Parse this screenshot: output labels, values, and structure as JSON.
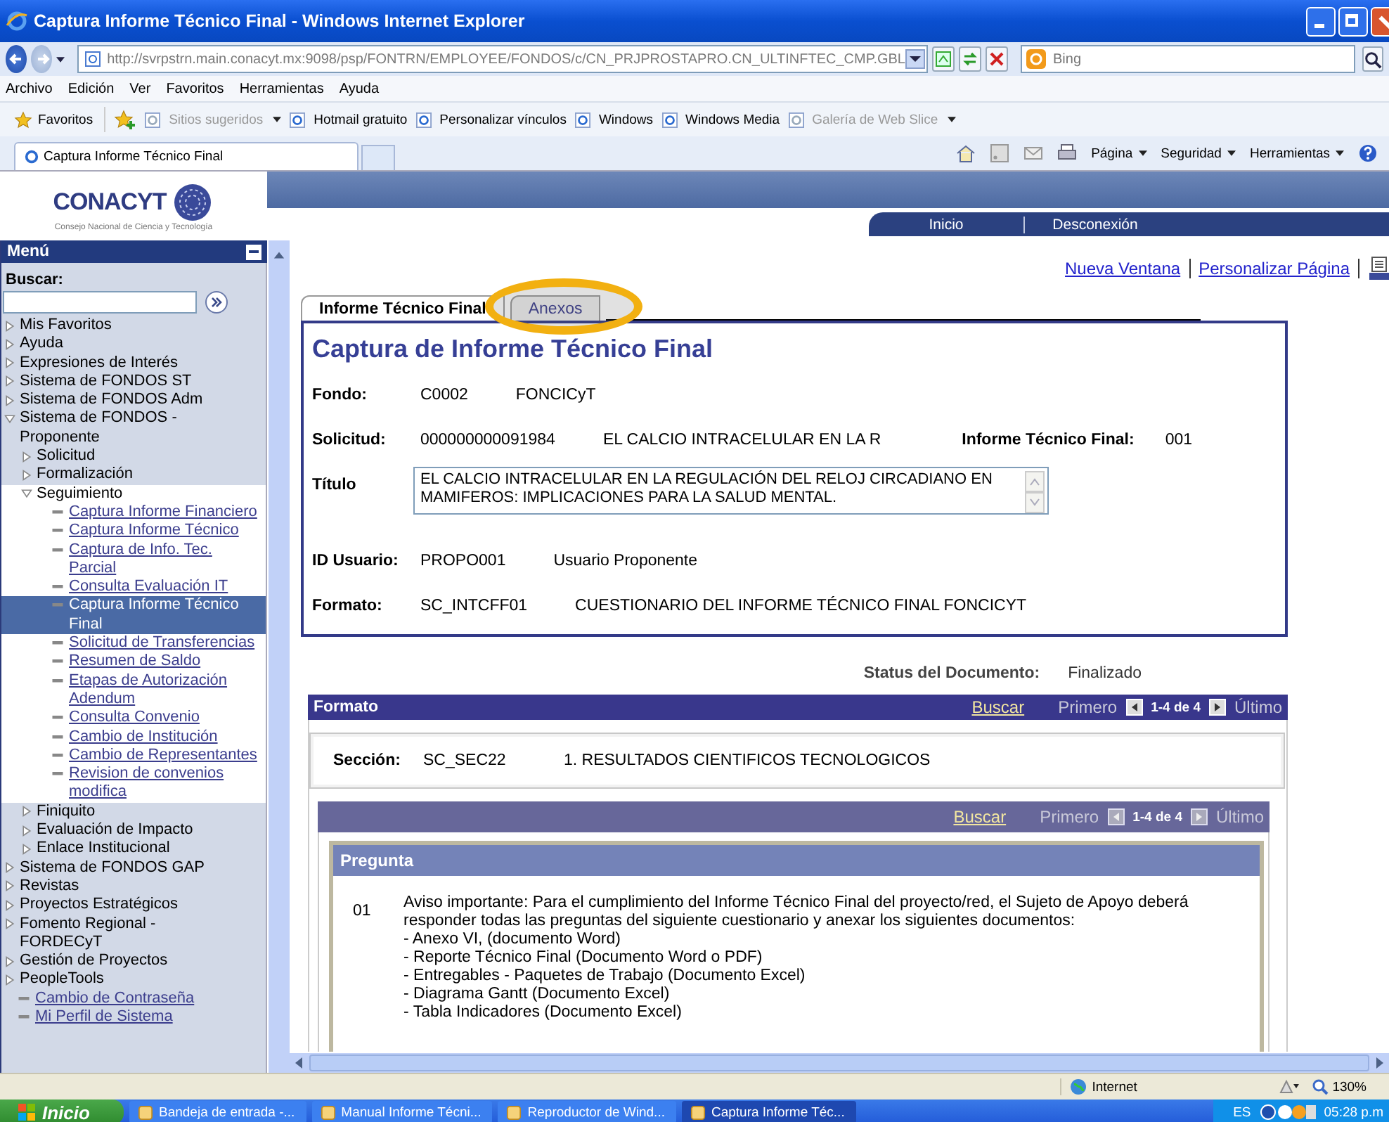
{
  "window": {
    "title": "Captura Informe Técnico Final - Windows Internet Explorer"
  },
  "address_bar": {
    "url": "http://svrpstrn.main.conacyt.mx:9098/psp/FONTRN/EMPLOYEE/FONDOS/c/CN_PRJPROSTAPRO.CN_ULTINFTEC_CMP.GBL"
  },
  "search": {
    "placeholder": "Bing"
  },
  "menu_bar": [
    "Archivo",
    "Edición",
    "Ver",
    "Favoritos",
    "Herramientas",
    "Ayuda"
  ],
  "favorites_bar": {
    "label": "Favoritos",
    "items": [
      {
        "label": "Sitios sugeridos",
        "dropdown": true,
        "disabled": true
      },
      {
        "label": "Hotmail gratuito",
        "dropdown": false,
        "disabled": false
      },
      {
        "label": "Personalizar vínculos",
        "dropdown": false,
        "disabled": false
      },
      {
        "label": "Windows",
        "dropdown": false,
        "disabled": false
      },
      {
        "label": "Windows Media",
        "dropdown": false,
        "disabled": false
      },
      {
        "label": "Galería de Web Slice",
        "dropdown": true,
        "disabled": true
      }
    ]
  },
  "browser_tab": {
    "title": "Captura Informe Técnico Final"
  },
  "command_bar": [
    "Página",
    "Seguridad",
    "Herramientas"
  ],
  "header": {
    "logo": "CONACYT",
    "logo_subtitle": "Consejo Nacional de Ciencia y Tecnología",
    "nav_links": [
      "Inicio",
      "Desconexión"
    ]
  },
  "sidebar": {
    "title": "Menú",
    "search_label": "Buscar:",
    "tree": [
      {
        "label": "Mis Favoritos",
        "kind": "folder",
        "expanded": false
      },
      {
        "label": "Ayuda",
        "kind": "folder",
        "expanded": false
      },
      {
        "label": "Expresiones de Interés",
        "kind": "folder",
        "expanded": false
      },
      {
        "label": "Sistema de FONDOS ST",
        "kind": "folder",
        "expanded": false
      },
      {
        "label": "Sistema de FONDOS Adm",
        "kind": "folder",
        "expanded": false
      },
      {
        "label": "Sistema de FONDOS - Proponente",
        "kind": "folder",
        "expanded": true,
        "children": [
          {
            "label": "Solicitud",
            "kind": "folder",
            "expanded": false
          },
          {
            "label": "Formalización",
            "kind": "folder",
            "expanded": false
          },
          {
            "label": "Seguimiento",
            "kind": "folder",
            "expanded": true,
            "children": [
              {
                "label": "Captura Informe Financiero",
                "kind": "link",
                "selected": false
              },
              {
                "label": "Captura Informe Técnico",
                "kind": "link",
                "selected": false
              },
              {
                "label": "Captura de Info. Tec. Parcial",
                "kind": "link",
                "selected": false
              },
              {
                "label": "Consulta Evaluación IT",
                "kind": "link",
                "selected": false
              },
              {
                "label": "Captura Informe Técnico Final",
                "kind": "link",
                "selected": true
              },
              {
                "label": "Solicitud de Transferencias",
                "kind": "link",
                "selected": false
              },
              {
                "label": "Resumen de Saldo",
                "kind": "link",
                "selected": false
              },
              {
                "label": "Etapas de Autorización Adendum",
                "kind": "link",
                "selected": false
              },
              {
                "label": "Consulta Convenio",
                "kind": "link",
                "selected": false
              },
              {
                "label": "Cambio de Institución",
                "kind": "link",
                "selected": false
              },
              {
                "label": "Cambio de Representantes",
                "kind": "link",
                "selected": false
              },
              {
                "label": "Revision de convenios modifica",
                "kind": "link",
                "selected": false
              }
            ]
          },
          {
            "label": "Finiquito",
            "kind": "folder",
            "expanded": false
          },
          {
            "label": "Evaluación de Impacto",
            "kind": "folder",
            "expanded": false
          },
          {
            "label": "Enlace Institucional",
            "kind": "folder",
            "expanded": false
          }
        ]
      },
      {
        "label": "Sistema de FONDOS GAP",
        "kind": "folder",
        "expanded": false
      },
      {
        "label": "Revistas",
        "kind": "folder",
        "expanded": false
      },
      {
        "label": "Proyectos Estratégicos",
        "kind": "folder",
        "expanded": false
      },
      {
        "label": "Fomento Regional - FORDECyT",
        "kind": "folder",
        "expanded": false
      },
      {
        "label": "Gestión de Proyectos",
        "kind": "folder",
        "expanded": false
      },
      {
        "label": "PeopleTools",
        "kind": "folder",
        "expanded": false
      },
      {
        "label": "Cambio de Contraseña",
        "kind": "link",
        "selected": false
      },
      {
        "label": "Mi Perfil de Sistema",
        "kind": "link",
        "selected": false
      }
    ]
  },
  "top_links": [
    "Nueva Ventana",
    "Personalizar Página"
  ],
  "tabs": [
    {
      "label": "Informe Técnico Final",
      "selected": true,
      "highlighted": false
    },
    {
      "label": "Anexos",
      "selected": false,
      "highlighted": true
    }
  ],
  "form": {
    "title": "Captura de Informe Técnico Final",
    "rows": [
      {
        "kind": "text",
        "label": "Fondo:",
        "values": [
          "C0002",
          "FONCICyT"
        ]
      },
      {
        "kind": "text",
        "label": "Solicitud:",
        "values": [
          "000000000091984",
          "EL CALCIO INTRACELULAR EN LA R"
        ],
        "extra_label": "Informe Técnico Final:",
        "extra_value": "001"
      },
      {
        "kind": "textarea",
        "label": "Título",
        "value": "EL CALCIO INTRACELULAR EN LA REGULACIÓN DEL RELOJ CIRCADIANO EN MAMIFEROS: IMPLICACIONES PARA LA SALUD MENTAL."
      },
      {
        "kind": "text",
        "label": "ID Usuario:",
        "values": [
          "PROPO001",
          "Usuario Proponente"
        ]
      },
      {
        "kind": "text",
        "label": "Formato:",
        "values": [
          "SC_INTCFF01",
          "CUESTIONARIO DEL INFORME TÉCNICO FINAL FONCICYT"
        ]
      }
    ]
  },
  "status": {
    "label": "Status del Documento:",
    "value": "Finalizado"
  },
  "formato_grid": {
    "title": "Formato",
    "search": "Buscar",
    "first": "Primero",
    "range": "1-4 de 4",
    "last": "Último"
  },
  "section": {
    "label": "Sección:",
    "code": "SC_SEC22",
    "name": "1. RESULTADOS CIENTIFICOS TECNOLOGICOS"
  },
  "question_grid": {
    "search": "Buscar",
    "first": "Primero",
    "range": "1-4 de 4",
    "last": "Último"
  },
  "question": {
    "title": "Pregunta",
    "number": "01",
    "text": "Aviso importante: Para el cumplimiento del Informe Técnico Final del proyecto/red, el Sujeto de Apoyo deberá responder todas las preguntas del siguiente cuestionario y anexar los siguientes documentos:",
    "items": [
      "- Anexo VI, (documento Word)",
      "- Reporte Técnico Final (Documento Word o PDF)",
      "- Entregables - Paquetes de Trabajo (Documento Excel)",
      "- Diagrama Gantt (Documento Excel)",
      "- Tabla Indicadores (Documento Excel)"
    ]
  },
  "status_bar": {
    "zone": "Internet",
    "zoom": "130%"
  },
  "taskbar": {
    "start": "Inicio",
    "tasks": [
      {
        "label": "Bandeja de entrada -...",
        "selected": false
      },
      {
        "label": "Manual Informe Técni...",
        "selected": false
      },
      {
        "label": "Reproductor de Wind...",
        "selected": false
      },
      {
        "label": "Captura Informe Téc...",
        "selected": true
      }
    ],
    "language": "ES",
    "clock": "05:28 p.m"
  }
}
